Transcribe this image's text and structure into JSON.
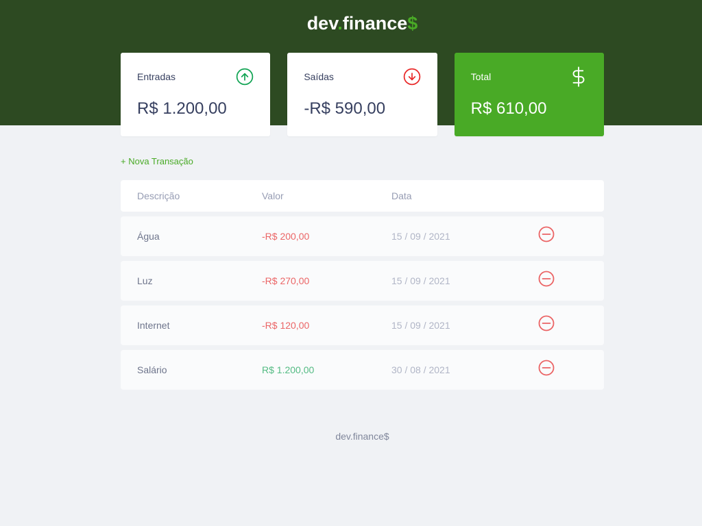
{
  "app": {
    "logo": {
      "part1": "dev",
      "dot": ".",
      "part2": "finance",
      "currency": "$"
    }
  },
  "balance": {
    "cards": [
      {
        "label": "Entradas",
        "value": "R$ 1.200,00",
        "icon": "arrow-up-circle-icon"
      },
      {
        "label": "Saídas",
        "value": "-R$ 590,00",
        "icon": "arrow-down-circle-icon"
      },
      {
        "label": "Total",
        "value": "R$ 610,00",
        "icon": "dollar-sign-icon"
      }
    ]
  },
  "transactions": {
    "new_label": "+ Nova Transação",
    "headers": {
      "description": "Descrição",
      "amount": "Valor",
      "date": "Data"
    },
    "remove_icon": "minus-circle-icon",
    "rows": [
      {
        "description": "Água",
        "amount": "-R$ 200,00",
        "date": "15 / 09 / 2021"
      },
      {
        "description": "Luz",
        "amount": "-R$ 270,00",
        "date": "15 / 09 / 2021"
      },
      {
        "description": "Internet",
        "amount": "-R$ 120,00",
        "date": "15 / 09 / 2021"
      },
      {
        "description": "Salário",
        "amount": "R$ 1.200,00",
        "date": "30 / 08 / 2021"
      }
    ]
  },
  "footer": {
    "text": "dev.finance$"
  },
  "colors": {
    "header_bg": "#2D4A22",
    "page_bg": "#F0F2F5",
    "accent": "#49AA26",
    "text": "#363F5F",
    "muted": "#969CB3",
    "income": "#12A454",
    "expense": "#E92929"
  }
}
